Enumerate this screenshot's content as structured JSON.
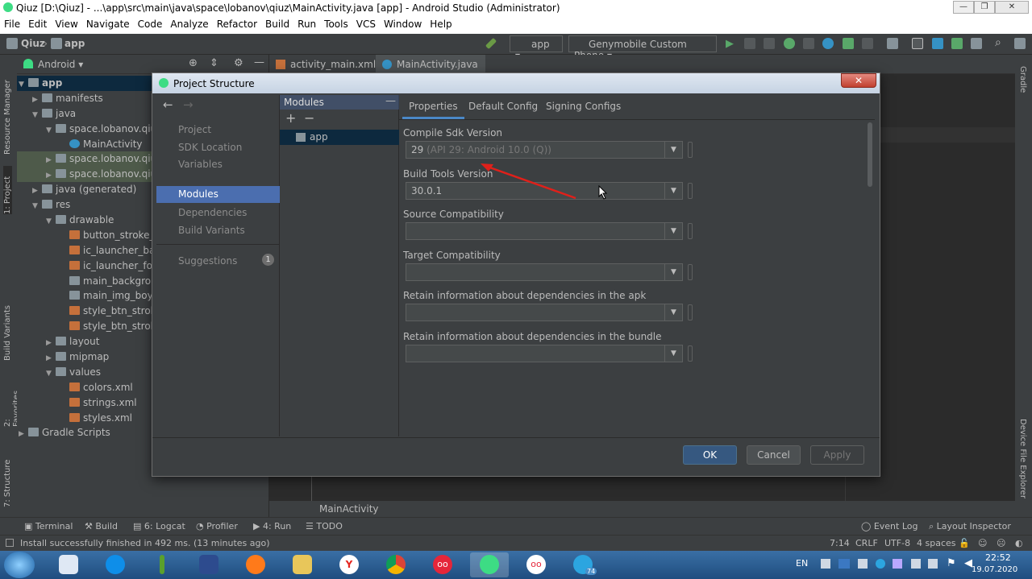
{
  "window": {
    "title": "Qiuz [D:\\Qiuz] - ...\\app\\src\\main\\java\\space\\lobanov\\qiuz\\MainActivity.java [app] - Android Studio (Administrator)"
  },
  "menu": [
    "File",
    "Edit",
    "View",
    "Navigate",
    "Code",
    "Analyze",
    "Refactor",
    "Build",
    "Run",
    "Tools",
    "VCS",
    "Window",
    "Help"
  ],
  "nav_breadcrumb": {
    "project": "Qiuz",
    "module": "app"
  },
  "toolbar": {
    "run_config": "app",
    "device": "Genymobile Custom Phone"
  },
  "left_stripe": {
    "resource_manager": "Resource Manager",
    "project": "1: Project",
    "build_variants": "Build Variants",
    "favorites": "2: Favorites",
    "structure": "7: Structure"
  },
  "right_stripe": {
    "gradle": "Gradle",
    "device_file_explorer": "Device File Explorer"
  },
  "project_panel": {
    "view_mode": "Android"
  },
  "tree": [
    {
      "label": "app",
      "depth": 0,
      "arrow": "▼",
      "icon": "fold",
      "bold": true,
      "sel": true
    },
    {
      "label": "manifests",
      "depth": 1,
      "arrow": "▶",
      "icon": "fold"
    },
    {
      "label": "java",
      "depth": 1,
      "arrow": "▼",
      "icon": "fold"
    },
    {
      "label": "space.lobanov.qiuz",
      "depth": 2,
      "arrow": "▼",
      "icon": "fold"
    },
    {
      "label": "MainActivity",
      "depth": 3,
      "arrow": "",
      "icon": "cls"
    },
    {
      "label": "space.lobanov.qiuz",
      "depth": 2,
      "arrow": "▶",
      "icon": "fold",
      "hl": true
    },
    {
      "label": "space.lobanov.qiuz",
      "depth": 2,
      "arrow": "▶",
      "icon": "fold",
      "hl": true
    },
    {
      "label": "java (generated)",
      "depth": 1,
      "arrow": "▶",
      "icon": "fold"
    },
    {
      "label": "res",
      "depth": 1,
      "arrow": "▼",
      "icon": "fold"
    },
    {
      "label": "drawable",
      "depth": 2,
      "arrow": "▼",
      "icon": "fold"
    },
    {
      "label": "button_stroke_bl",
      "depth": 3,
      "arrow": "",
      "icon": "xml"
    },
    {
      "label": "ic_launcher_back",
      "depth": 3,
      "arrow": "",
      "icon": "xml"
    },
    {
      "label": "ic_launcher_fore",
      "depth": 3,
      "arrow": "",
      "icon": "xml"
    },
    {
      "label": "main_backgroun",
      "depth": 3,
      "arrow": "",
      "icon": "fold"
    },
    {
      "label": "main_img_boy.p",
      "depth": 3,
      "arrow": "",
      "icon": "fold"
    },
    {
      "label": "style_btn_stroke_",
      "depth": 3,
      "arrow": "",
      "icon": "xml"
    },
    {
      "label": "style_btn_stroke_",
      "depth": 3,
      "arrow": "",
      "icon": "xml"
    },
    {
      "label": "layout",
      "depth": 2,
      "arrow": "▶",
      "icon": "fold"
    },
    {
      "label": "mipmap",
      "depth": 2,
      "arrow": "▶",
      "icon": "fold"
    },
    {
      "label": "values",
      "depth": 2,
      "arrow": "▼",
      "icon": "fold"
    },
    {
      "label": "colors.xml",
      "depth": 3,
      "arrow": "",
      "icon": "xml"
    },
    {
      "label": "strings.xml",
      "depth": 3,
      "arrow": "",
      "icon": "xml"
    },
    {
      "label": "styles.xml",
      "depth": 3,
      "arrow": "",
      "icon": "xml"
    },
    {
      "label": "Gradle Scripts",
      "depth": 0,
      "arrow": "▶",
      "icon": "fold"
    }
  ],
  "editor_tabs": [
    {
      "label": "activity_main.xml",
      "icon": "xml"
    },
    {
      "label": "MainActivity.java",
      "icon": "cls",
      "active": true
    }
  ],
  "editor_breadcrumb": "MainActivity",
  "dialog": {
    "title": "Project Structure",
    "close": "✕",
    "nav_items": [
      "Project",
      "SDK Location",
      "Variables",
      "Modules",
      "Dependencies",
      "Build Variants",
      "Suggestions"
    ],
    "suggestions_count": "1",
    "modules_header": "Modules",
    "modules": [
      "app"
    ],
    "tabs": [
      "Properties",
      "Default Config",
      "Signing Configs"
    ],
    "fields": [
      {
        "label": "Compile Sdk Version",
        "value": "29",
        "hint": "(API 29: Android 10.0 (Q))"
      },
      {
        "label": "Build Tools Version",
        "value": "30.0.1",
        "hint": ""
      },
      {
        "label": "Source Compatibility",
        "value": "",
        "hint": ""
      },
      {
        "label": "Target Compatibility",
        "value": "",
        "hint": ""
      },
      {
        "label": "Retain information about dependencies in the apk",
        "value": "",
        "hint": ""
      },
      {
        "label": "Retain information about dependencies in the bundle",
        "value": "",
        "hint": ""
      }
    ],
    "buttons": {
      "ok": "OK",
      "cancel": "Cancel",
      "apply": "Apply"
    }
  },
  "tool_windows": {
    "terminal": "Terminal",
    "build": "Build",
    "logcat": "6: Logcat",
    "profiler": "Profiler",
    "run": "4: Run",
    "todo": "TODO",
    "event_log": "Event Log",
    "layout_inspector": "Layout Inspector"
  },
  "status": {
    "message": "Install successfully finished in 492 ms. (13 minutes ago)",
    "position": "7:14",
    "line_sep": "CRLF",
    "encoding": "UTF-8",
    "indent": "4 spaces"
  },
  "taskbar": {
    "lang": "EN",
    "time": "22:52",
    "date": "19.07.2020",
    "telegram_badge": "74"
  },
  "colors": {
    "accent": "#4b6eaf",
    "ok_button": "#365880",
    "annotation_arrow": "#e0201a"
  }
}
